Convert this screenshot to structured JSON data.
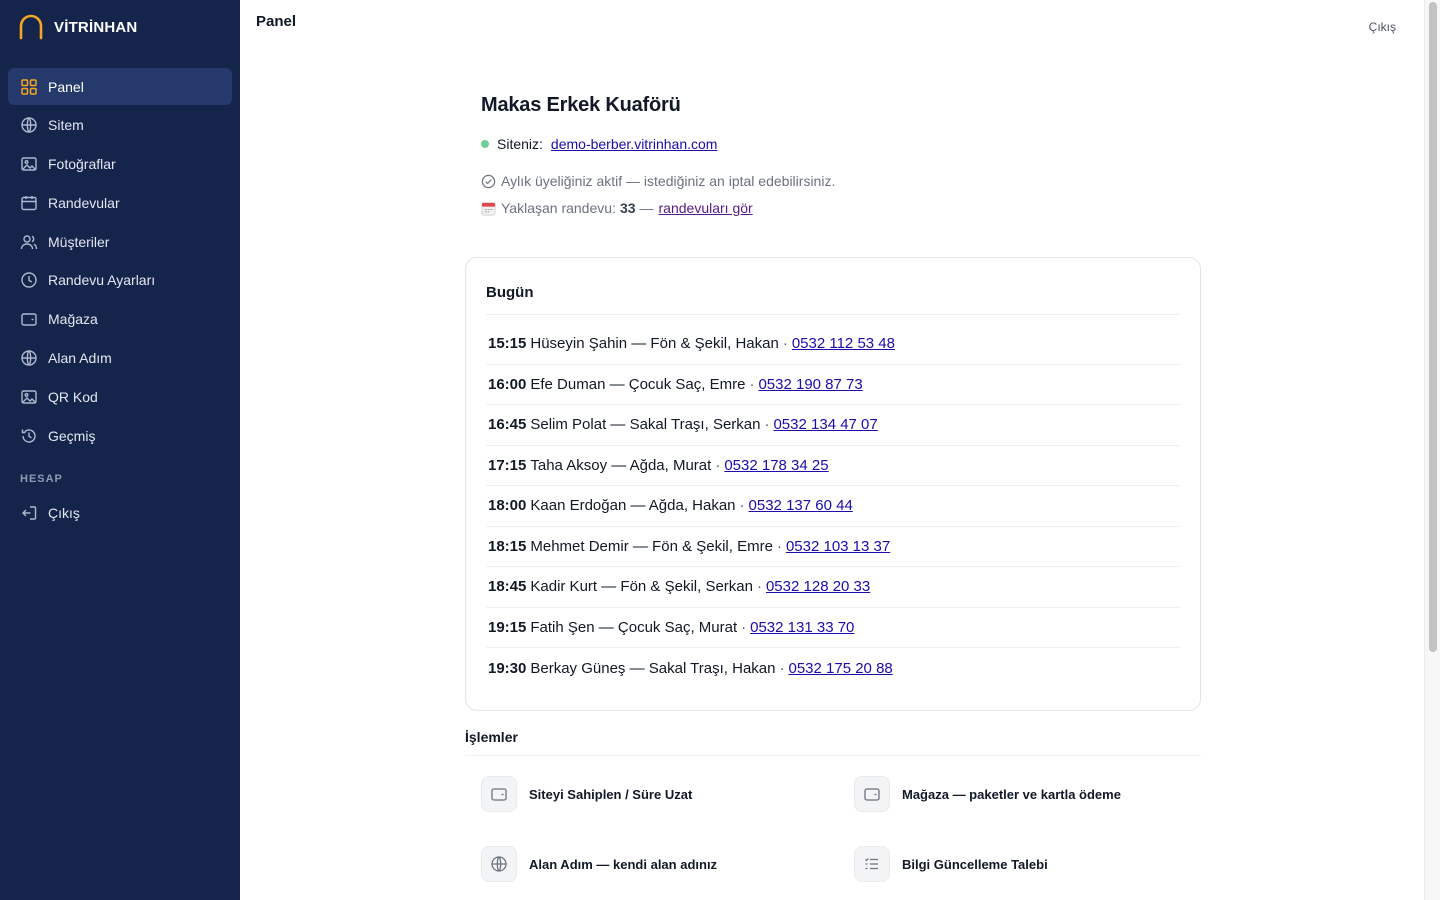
{
  "brand": {
    "name": "VİTRİNHAN",
    "logo_color": "#f5a623"
  },
  "sidebar": {
    "items": [
      {
        "label": "Panel",
        "icon": "grid-icon",
        "active": true
      },
      {
        "label": "Sitem",
        "icon": "globe-icon"
      },
      {
        "label": "Fotoğraflar",
        "icon": "image-icon"
      },
      {
        "label": "Randevular",
        "icon": "calendar-icon"
      },
      {
        "label": "Müşteriler",
        "icon": "users-icon"
      },
      {
        "label": "Randevu Ayarları",
        "icon": "clock-icon"
      },
      {
        "label": "Mağaza",
        "icon": "wallet-icon"
      },
      {
        "label": "Alan Adım",
        "icon": "globe-icon"
      },
      {
        "label": "QR Kod",
        "icon": "image-icon"
      },
      {
        "label": "Geçmiş",
        "icon": "history-icon"
      }
    ],
    "section_label": "HESAP",
    "account_items": [
      {
        "label": "Çıkış",
        "icon": "logout-icon"
      }
    ]
  },
  "header": {
    "title": "Panel",
    "logout": "Çıkış"
  },
  "business": {
    "name": "Makas Erkek Kuaförü",
    "site_label": "Siteniz:",
    "site_url": "demo-berber.vitrinhan.com",
    "membership_text": "Aylık üyeliğiniz aktif — istediğiniz an iptal edebilirsiniz.",
    "upcoming_label": "Yaklaşan randevu:",
    "upcoming_count": "33",
    "upcoming_dash": "—",
    "upcoming_link": "randevuları gör"
  },
  "today": {
    "title": "Bugün",
    "appointments": [
      {
        "time": "15:15",
        "text": "Hüseyin Şahin — Fön & Şekil, Hakan",
        "phone": "0532 112 53 48"
      },
      {
        "time": "16:00",
        "text": "Efe Duman — Çocuk Saç, Emre",
        "phone": "0532 190 87 73"
      },
      {
        "time": "16:45",
        "text": "Selim Polat — Sakal Traşı, Serkan",
        "phone": "0532 134 47 07"
      },
      {
        "time": "17:15",
        "text": "Taha Aksoy — Ağda, Murat",
        "phone": "0532 178 34 25"
      },
      {
        "time": "18:00",
        "text": "Kaan Erdoğan — Ağda, Hakan",
        "phone": "0532 137 60 44"
      },
      {
        "time": "18:15",
        "text": "Mehmet Demir — Fön & Şekil, Emre",
        "phone": "0532 103 13 37"
      },
      {
        "time": "18:45",
        "text": "Kadir Kurt — Fön & Şekil, Serkan",
        "phone": "0532 128 20 33"
      },
      {
        "time": "19:15",
        "text": "Fatih Şen — Çocuk Saç, Murat",
        "phone": "0532 131 33 70"
      },
      {
        "time": "19:30",
        "text": "Berkay Güneş — Sakal Traşı, Hakan",
        "phone": "0532 175 20 88"
      }
    ]
  },
  "actions": {
    "title": "İşlemler",
    "items": [
      {
        "label": "Siteyi Sahiplen / Süre Uzat",
        "icon": "wallet-icon"
      },
      {
        "label": "Mağaza — paketler ve kartla ödeme",
        "icon": "wallet-icon"
      },
      {
        "label": "Alan Adım — kendi alan adınız",
        "icon": "globe-icon"
      },
      {
        "label": "Bilgi Güncelleme Talebi",
        "icon": "list-icon"
      }
    ]
  }
}
